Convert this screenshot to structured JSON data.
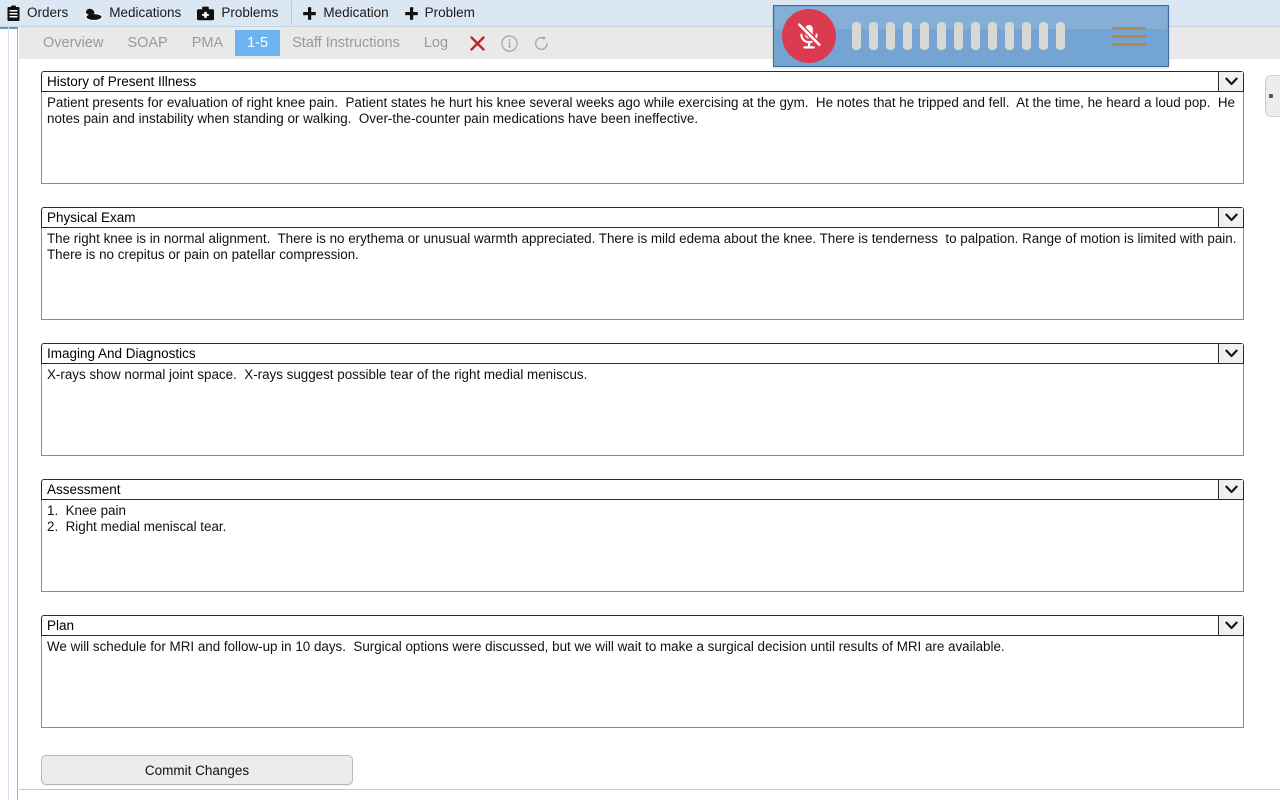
{
  "toolbar": {
    "items": [
      {
        "icon": "clipboard-icon",
        "label": "Orders"
      },
      {
        "icon": "pills-icon",
        "label": "Medications"
      },
      {
        "icon": "medical-bag-icon",
        "label": "Problems"
      }
    ],
    "actions": [
      {
        "icon": "plus-icon",
        "label": "Medication"
      },
      {
        "icon": "plus-icon",
        "label": "Problem"
      }
    ]
  },
  "tabs": {
    "items": [
      {
        "label": "Overview",
        "active": false
      },
      {
        "label": "SOAP",
        "active": false
      },
      {
        "label": "PMA",
        "active": false
      },
      {
        "label": "1-5",
        "active": true
      },
      {
        "label": "Staff Instructions",
        "active": false
      },
      {
        "label": "Log",
        "active": false
      }
    ],
    "icons": [
      {
        "name": "close-icon",
        "glyph": "✕",
        "color": "#d11f1f"
      },
      {
        "name": "info-icon",
        "glyph": "ⓘ",
        "color": "#9d9d9d"
      },
      {
        "name": "refresh-icon",
        "glyph": "⟳",
        "color": "#9d9d9d"
      }
    ],
    "active_color": "#6cb3ef"
  },
  "dictation": {
    "state": "muted",
    "mic_icon": "microphone-muted-icon",
    "mic_button_color": "#dc3b4f",
    "panel_color": "#74a4d2",
    "waveform_bars": 13,
    "menu_icon": "hamburger-menu-icon"
  },
  "note": {
    "dropdown_icon": "chevron-down-icon",
    "sections": [
      {
        "title": "History of Present Illness",
        "body": "Patient presents for evaluation of right knee pain.  Patient states he hurt his knee several weeks ago while exercising at the gym.  He notes that he tripped and fell.  At the time, he heard a loud pop.  He notes pain and instability when standing or walking.  Over-the-counter pain medications have been ineffective."
      },
      {
        "title": "Physical Exam",
        "body": "The right knee is in normal alignment.  There is no erythema or unusual warmth appreciated. There is mild edema about the knee. There is tenderness  to palpation. Range of motion is limited with pain. There is no crepitus or pain on patellar compression."
      },
      {
        "title": "Imaging And Diagnostics",
        "body": "X-rays show normal joint space.  X-rays suggest possible tear of the right medial meniscus."
      },
      {
        "title": "Assessment",
        "body": "1.  Knee pain\n2.  Right medial meniscal tear."
      },
      {
        "title": "Plan",
        "body": "We will schedule for MRI and follow-up in 10 days.  Surgical options were discussed, but we will wait to make a surgical decision until results of MRI are available."
      }
    ]
  },
  "footer": {
    "commit_label": "Commit Changes"
  }
}
